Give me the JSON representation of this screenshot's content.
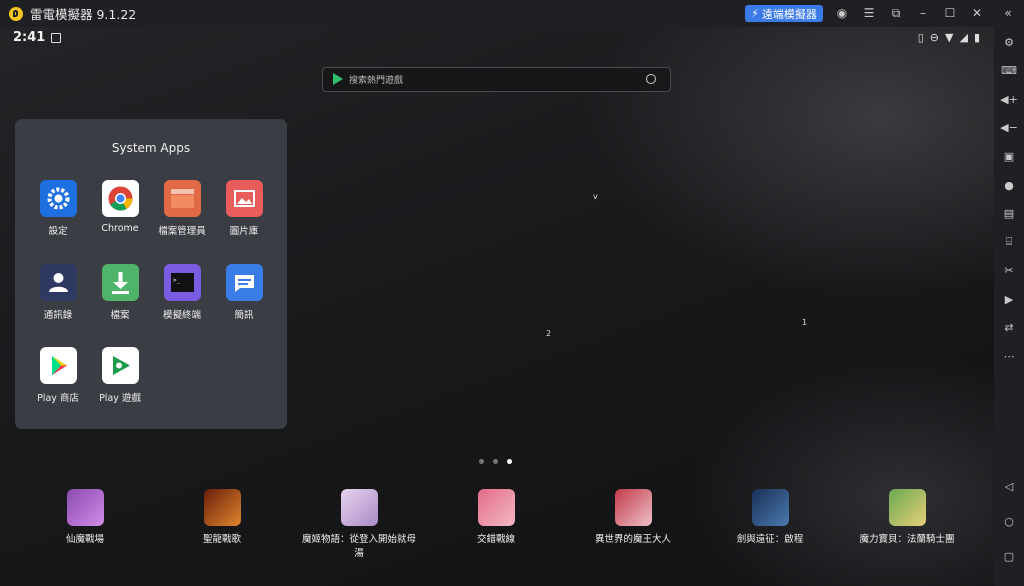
{
  "window": {
    "title": "雷電模擬器 9.1.22",
    "remote_button": "遠端模擬器",
    "icons": [
      "account-icon",
      "menu-icon",
      "restore-icon",
      "minimize-icon",
      "maximize-icon",
      "close-icon",
      "collapse-icon"
    ]
  },
  "status": {
    "time": "2:41"
  },
  "search": {
    "placeholder": "搜索熱門遊戲"
  },
  "folder": {
    "title": "System Apps",
    "apps": [
      {
        "label": "設定",
        "color": "#1e6fe0",
        "icon": "settings-icon"
      },
      {
        "label": "Chrome",
        "color": "#ffffff",
        "icon": "chrome-icon"
      },
      {
        "label": "檔案管理員",
        "color": "#e06a45",
        "icon": "file-manager-icon"
      },
      {
        "label": "圖片庫",
        "color": "#e85c5c",
        "icon": "gallery-icon"
      },
      {
        "label": "通訊錄",
        "color": "#3a4a7a",
        "icon": "contacts-icon"
      },
      {
        "label": "檔案",
        "color": "#4fb36a",
        "icon": "download-icon"
      },
      {
        "label": "模擬終端",
        "color": "#7a5ce0",
        "icon": "terminal-icon"
      },
      {
        "label": "簡訊",
        "color": "#3a7de8",
        "icon": "messages-icon"
      },
      {
        "label": "Play 商店",
        "color": "#ffffff",
        "icon": "play-store-icon"
      },
      {
        "label": "Play 遊戲",
        "color": "#ffffff",
        "icon": "play-games-icon"
      }
    ]
  },
  "markers": {
    "v": "v",
    "two": "2",
    "one": "1"
  },
  "dock": [
    {
      "label": "仙魔戰場",
      "color": "#8a4bb0"
    },
    {
      "label": "聖龍戰歌",
      "color": "#b04a1e"
    },
    {
      "label": "魔姬物語：從登入開始就母湯",
      "color": "#d9b7e0"
    },
    {
      "label": "交錯戰線",
      "color": "#e36b8a"
    },
    {
      "label": "異世界的魔王大人",
      "color": "#c23a4a"
    },
    {
      "label": "劍與遠征：啟程",
      "color": "#2a4a7a"
    },
    {
      "label": "魔力寶貝：法蘭騎士團",
      "color": "#6aa84f"
    }
  ],
  "sidebar_icons": [
    "settings-icon",
    "keyboard-icon",
    "volume-up-icon",
    "volume-down-icon",
    "screenshot-icon",
    "location-icon",
    "apk-icon",
    "macro-icon",
    "scissors-icon",
    "record-icon",
    "sync-icon",
    "more-icon",
    "back-icon",
    "home-icon",
    "recents-icon"
  ]
}
